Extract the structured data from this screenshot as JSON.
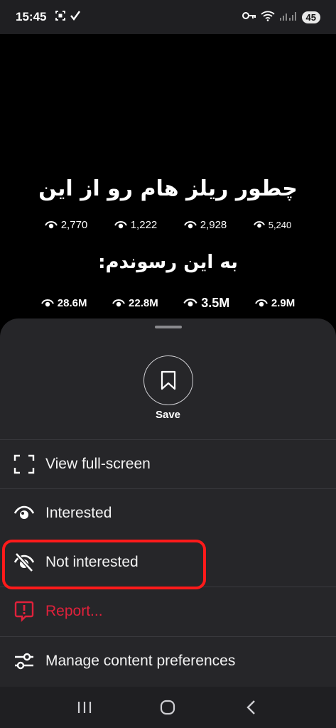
{
  "status_bar": {
    "time": "15:45",
    "battery": "45"
  },
  "video": {
    "title_line1": "چطور ریلز هام رو از این",
    "title_line2": "به این رسوندم:",
    "stats_before": [
      "2,770",
      "1,222",
      "2,928",
      "5,240"
    ],
    "stats_after": [
      "28.6M",
      "22.8M",
      "3.5M",
      "2.9M"
    ]
  },
  "sheet": {
    "save_label": "Save",
    "items": [
      {
        "label": "View full-screen",
        "icon": "fullscreen-icon"
      },
      {
        "label": "Interested",
        "icon": "eye-icon"
      },
      {
        "label": "Not interested",
        "icon": "eye-off-icon"
      },
      {
        "label": "Report...",
        "icon": "report-icon"
      },
      {
        "label": "Manage content preferences",
        "icon": "sliders-icon"
      }
    ]
  },
  "colors": {
    "sheet_bg": "#262629",
    "report_red": "#e0213b",
    "highlight_red": "#ff1a1a"
  }
}
